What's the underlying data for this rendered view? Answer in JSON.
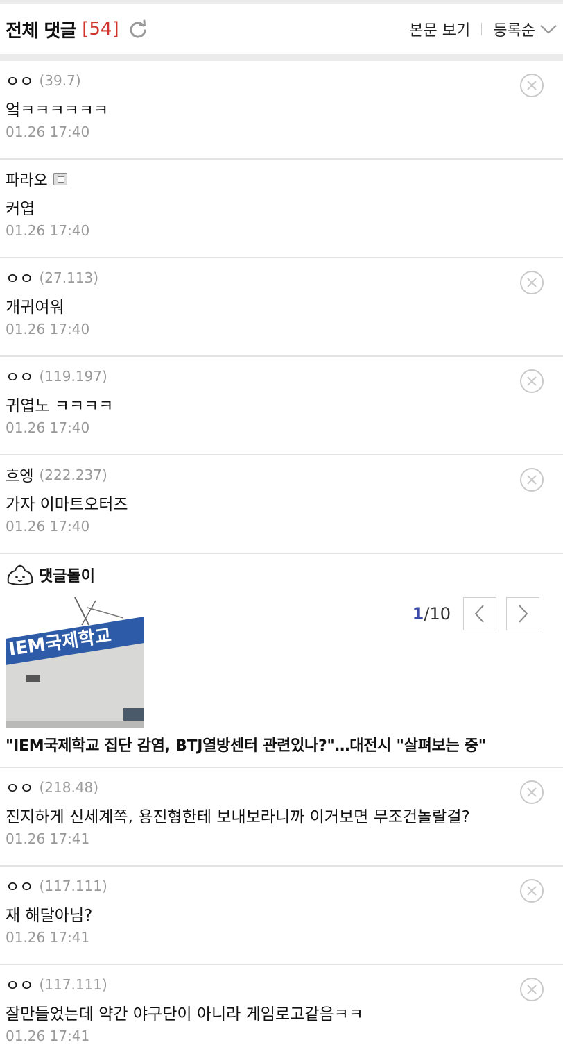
{
  "header": {
    "title": "전체 댓글",
    "count": "[54]",
    "view_body_label": "본문 보기",
    "sort_label": "등록순"
  },
  "comments_top": [
    {
      "nick": "ㅇㅇ",
      "ip": "(39.7)",
      "text": "엌ㅋㅋㅋㅋㅋㅋ",
      "date": "01.26 17:40",
      "deletable": true
    },
    {
      "nick": "파라오",
      "ip": "",
      "badge": true,
      "text": "커엽",
      "date": "01.26 17:40",
      "deletable": false
    },
    {
      "nick": "ㅇㅇ",
      "ip": "(27.113)",
      "text": "개귀여워",
      "date": "01.26 17:40",
      "deletable": true
    },
    {
      "nick": "ㅇㅇ",
      "ip": "(119.197)",
      "text": "귀엽노 ㅋㅋㅋㅋ",
      "date": "01.26 17:40",
      "deletable": true
    },
    {
      "nick": "흐엥",
      "ip": "(222.237)",
      "text": "가자 이마트오터즈",
      "date": "01.26 17:40",
      "deletable": true
    }
  ],
  "bot": {
    "label": "댓글돌이",
    "image_sign_text": "IEM국제학교",
    "page_current": "1",
    "page_total": "/10",
    "headline": "\"IEM국제학교 집단 감염, BTJ열방센터 관련있나?\"…대전시 \"살펴보는 중\""
  },
  "comments_bottom": [
    {
      "nick": "ㅇㅇ",
      "ip": "(218.48)",
      "text": "진지하게 신세계쪽, 용진형한테 보내보라니까 이거보면 무조건놀랄걸?",
      "date": "01.26 17:41",
      "deletable": true
    },
    {
      "nick": "ㅇㅇ",
      "ip": "(117.111)",
      "text": "재 해달아님?",
      "date": "01.26 17:41",
      "deletable": true
    },
    {
      "nick": "ㅇㅇ",
      "ip": "(117.111)",
      "text": "잘만들었는데 약간 야구단이 아니라 게임로고같음ㅋㅋ",
      "date": "01.26 17:41",
      "deletable": true
    }
  ],
  "colors": {
    "count": "#d0342c",
    "pager_current": "#3d4aa8",
    "band": "#ebebeb"
  }
}
